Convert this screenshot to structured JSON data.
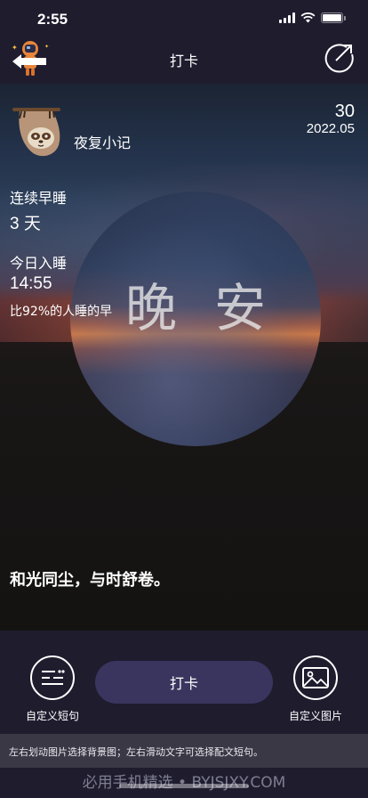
{
  "status_bar": {
    "time": "2:55",
    "icons": [
      "signal-icon",
      "wifi-icon",
      "battery-icon"
    ]
  },
  "nav": {
    "title": "打卡",
    "back_icon": "astronaut-back-icon",
    "share_icon": "share-arrow-icon"
  },
  "card": {
    "app_label": "夜复小记",
    "avatar_icon": "sloth-icon",
    "day": "30",
    "month": "2022.05",
    "streak_label": "连续早睡",
    "streak_value": "3 天",
    "sleep_label": "今日入睡",
    "sleep_time": "14:55",
    "compare_note": "比92%的人睡的早",
    "moon_text": "晚安",
    "quote": "和光同尘，与时舒卷。"
  },
  "actions": {
    "custom_quote_label": "自定义短句",
    "checkin_label": "打卡",
    "custom_image_label": "自定义图片"
  },
  "hint": "左右划动图片选择背景图；左右滑动文字可选择配文短句。",
  "watermark": "必用手机精选 • BYJSJXY.COM",
  "colors": {
    "background": "#1f1c2e",
    "button": "#39355f",
    "hint_bar": "#3b3845"
  }
}
